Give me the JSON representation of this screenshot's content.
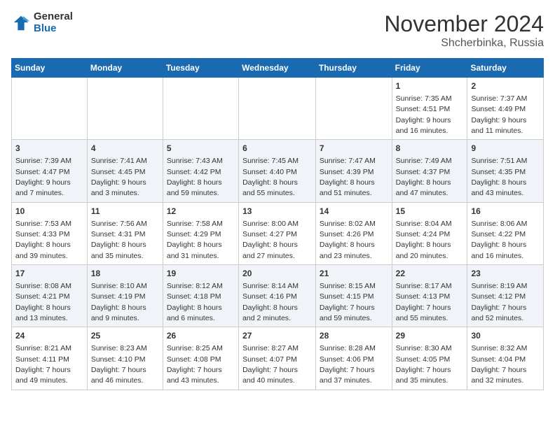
{
  "header": {
    "logo_general": "General",
    "logo_blue": "Blue",
    "month_title": "November 2024",
    "location": "Shcherbinka, Russia"
  },
  "days_of_week": [
    "Sunday",
    "Monday",
    "Tuesday",
    "Wednesday",
    "Thursday",
    "Friday",
    "Saturday"
  ],
  "weeks": [
    [
      {
        "day": "",
        "info": ""
      },
      {
        "day": "",
        "info": ""
      },
      {
        "day": "",
        "info": ""
      },
      {
        "day": "",
        "info": ""
      },
      {
        "day": "",
        "info": ""
      },
      {
        "day": "1",
        "info": "Sunrise: 7:35 AM\nSunset: 4:51 PM\nDaylight: 9 hours and 16 minutes."
      },
      {
        "day": "2",
        "info": "Sunrise: 7:37 AM\nSunset: 4:49 PM\nDaylight: 9 hours and 11 minutes."
      }
    ],
    [
      {
        "day": "3",
        "info": "Sunrise: 7:39 AM\nSunset: 4:47 PM\nDaylight: 9 hours and 7 minutes."
      },
      {
        "day": "4",
        "info": "Sunrise: 7:41 AM\nSunset: 4:45 PM\nDaylight: 9 hours and 3 minutes."
      },
      {
        "day": "5",
        "info": "Sunrise: 7:43 AM\nSunset: 4:42 PM\nDaylight: 8 hours and 59 minutes."
      },
      {
        "day": "6",
        "info": "Sunrise: 7:45 AM\nSunset: 4:40 PM\nDaylight: 8 hours and 55 minutes."
      },
      {
        "day": "7",
        "info": "Sunrise: 7:47 AM\nSunset: 4:39 PM\nDaylight: 8 hours and 51 minutes."
      },
      {
        "day": "8",
        "info": "Sunrise: 7:49 AM\nSunset: 4:37 PM\nDaylight: 8 hours and 47 minutes."
      },
      {
        "day": "9",
        "info": "Sunrise: 7:51 AM\nSunset: 4:35 PM\nDaylight: 8 hours and 43 minutes."
      }
    ],
    [
      {
        "day": "10",
        "info": "Sunrise: 7:53 AM\nSunset: 4:33 PM\nDaylight: 8 hours and 39 minutes."
      },
      {
        "day": "11",
        "info": "Sunrise: 7:56 AM\nSunset: 4:31 PM\nDaylight: 8 hours and 35 minutes."
      },
      {
        "day": "12",
        "info": "Sunrise: 7:58 AM\nSunset: 4:29 PM\nDaylight: 8 hours and 31 minutes."
      },
      {
        "day": "13",
        "info": "Sunrise: 8:00 AM\nSunset: 4:27 PM\nDaylight: 8 hours and 27 minutes."
      },
      {
        "day": "14",
        "info": "Sunrise: 8:02 AM\nSunset: 4:26 PM\nDaylight: 8 hours and 23 minutes."
      },
      {
        "day": "15",
        "info": "Sunrise: 8:04 AM\nSunset: 4:24 PM\nDaylight: 8 hours and 20 minutes."
      },
      {
        "day": "16",
        "info": "Sunrise: 8:06 AM\nSunset: 4:22 PM\nDaylight: 8 hours and 16 minutes."
      }
    ],
    [
      {
        "day": "17",
        "info": "Sunrise: 8:08 AM\nSunset: 4:21 PM\nDaylight: 8 hours and 13 minutes."
      },
      {
        "day": "18",
        "info": "Sunrise: 8:10 AM\nSunset: 4:19 PM\nDaylight: 8 hours and 9 minutes."
      },
      {
        "day": "19",
        "info": "Sunrise: 8:12 AM\nSunset: 4:18 PM\nDaylight: 8 hours and 6 minutes."
      },
      {
        "day": "20",
        "info": "Sunrise: 8:14 AM\nSunset: 4:16 PM\nDaylight: 8 hours and 2 minutes."
      },
      {
        "day": "21",
        "info": "Sunrise: 8:15 AM\nSunset: 4:15 PM\nDaylight: 7 hours and 59 minutes."
      },
      {
        "day": "22",
        "info": "Sunrise: 8:17 AM\nSunset: 4:13 PM\nDaylight: 7 hours and 55 minutes."
      },
      {
        "day": "23",
        "info": "Sunrise: 8:19 AM\nSunset: 4:12 PM\nDaylight: 7 hours and 52 minutes."
      }
    ],
    [
      {
        "day": "24",
        "info": "Sunrise: 8:21 AM\nSunset: 4:11 PM\nDaylight: 7 hours and 49 minutes."
      },
      {
        "day": "25",
        "info": "Sunrise: 8:23 AM\nSunset: 4:10 PM\nDaylight: 7 hours and 46 minutes."
      },
      {
        "day": "26",
        "info": "Sunrise: 8:25 AM\nSunset: 4:08 PM\nDaylight: 7 hours and 43 minutes."
      },
      {
        "day": "27",
        "info": "Sunrise: 8:27 AM\nSunset: 4:07 PM\nDaylight: 7 hours and 40 minutes."
      },
      {
        "day": "28",
        "info": "Sunrise: 8:28 AM\nSunset: 4:06 PM\nDaylight: 7 hours and 37 minutes."
      },
      {
        "day": "29",
        "info": "Sunrise: 8:30 AM\nSunset: 4:05 PM\nDaylight: 7 hours and 35 minutes."
      },
      {
        "day": "30",
        "info": "Sunrise: 8:32 AM\nSunset: 4:04 PM\nDaylight: 7 hours and 32 minutes."
      }
    ]
  ]
}
